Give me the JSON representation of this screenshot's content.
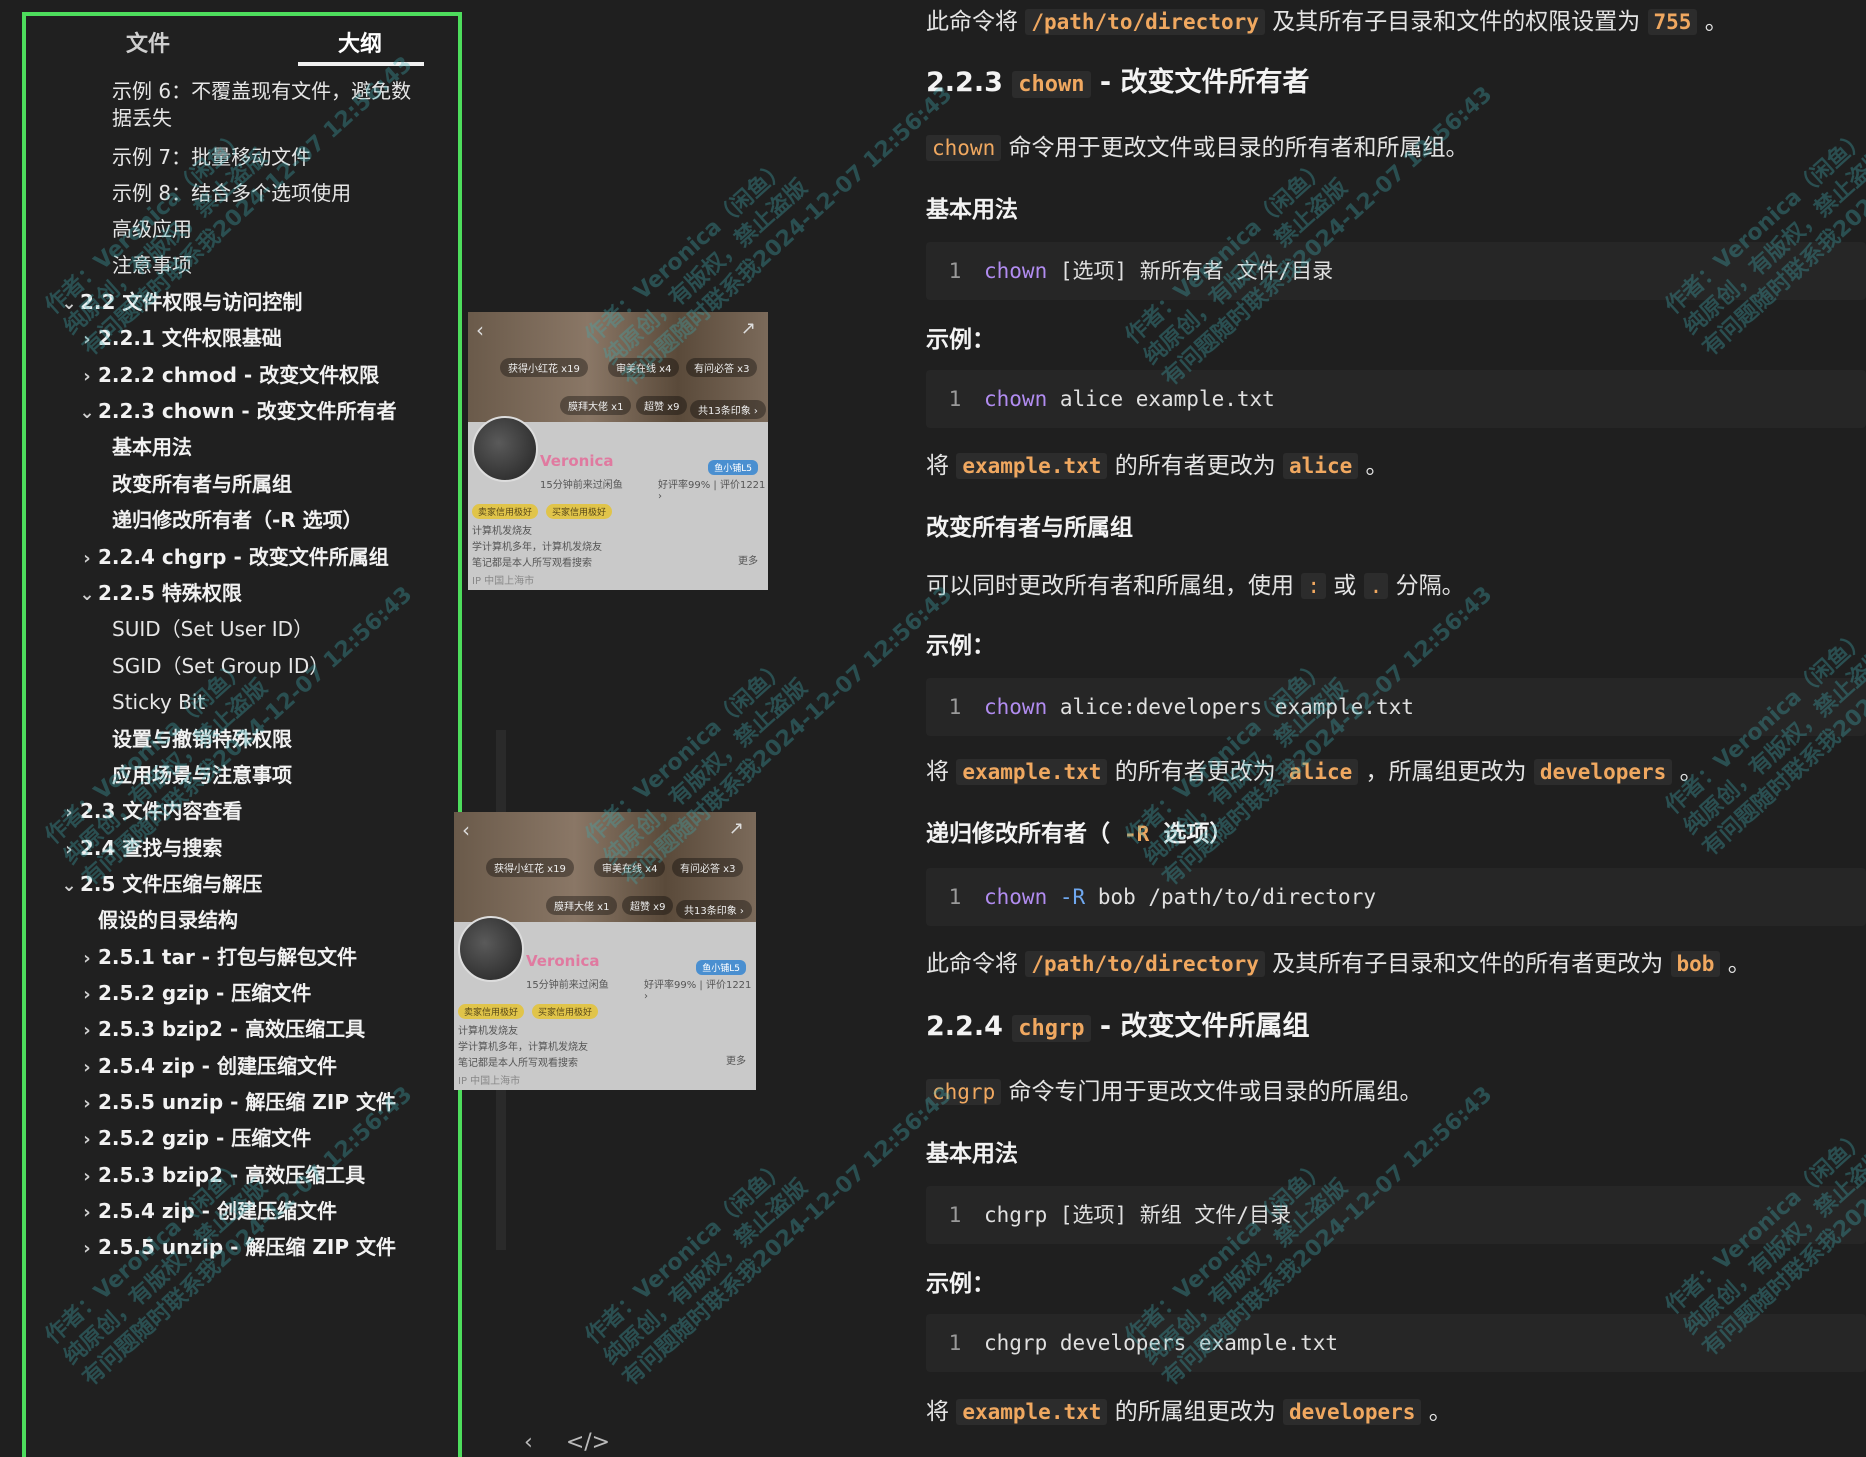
{
  "sidebar": {
    "tabs": [
      {
        "label": "文件",
        "active": false
      },
      {
        "label": "大纲",
        "active": true
      }
    ],
    "items": [
      {
        "text": "示例 6：不覆盖现有文件，避免数据丢失",
        "level": 3,
        "caret": ""
      },
      {
        "text": "示例 7：批量移动文件",
        "level": 3,
        "caret": ""
      },
      {
        "text": "示例 8：结合多个选项使用",
        "level": 3,
        "caret": ""
      },
      {
        "text": "高级应用",
        "level": 3,
        "caret": ""
      },
      {
        "text": "注意事项",
        "level": 3,
        "caret": ""
      },
      {
        "text": "2.2 文件权限与访问控制",
        "level": 1,
        "caret": "⌄"
      },
      {
        "text": "2.2.1 文件权限基础",
        "level": 2,
        "caret": "›"
      },
      {
        "text": "2.2.2 chmod - 改变文件权限",
        "level": 2,
        "caret": "›"
      },
      {
        "text": "2.2.3 chown - 改变文件所有者",
        "level": 2,
        "caret": "⌄"
      },
      {
        "text": "基本用法",
        "level": 3,
        "caret": ""
      },
      {
        "text": "改变所有者与所属组",
        "level": 3,
        "caret": ""
      },
      {
        "text": "递归修改所有者（-R 选项）",
        "level": 3,
        "caret": ""
      },
      {
        "text": "2.2.4 chgrp - 改变文件所属组",
        "level": 2,
        "caret": "›"
      },
      {
        "text": "2.2.5 特殊权限",
        "level": 2,
        "caret": "⌄"
      },
      {
        "text": "SUID（Set User ID）",
        "level": 3,
        "caret": ""
      },
      {
        "text": "SGID（Set Group ID）",
        "level": 3,
        "caret": ""
      },
      {
        "text": "Sticky Bit",
        "level": 3,
        "caret": ""
      },
      {
        "text": "设置与撤销特殊权限",
        "level": 3,
        "caret": ""
      },
      {
        "text": "应用场景与注意事项",
        "level": 3,
        "caret": ""
      },
      {
        "text": "2.3 文件内容查看",
        "level": 1,
        "caret": "›"
      },
      {
        "text": "2.4 查找与搜索",
        "level": 1,
        "caret": "›"
      },
      {
        "text": "2.5 文件压缩与解压",
        "level": 1,
        "caret": "⌄"
      },
      {
        "text": "假设的目录结构",
        "level": 2,
        "caret": ""
      },
      {
        "text": "2.5.1 tar - 打包与解包文件",
        "level": 2,
        "caret": "›"
      },
      {
        "text": "2.5.2 gzip - 压缩文件",
        "level": 2,
        "caret": "›"
      },
      {
        "text": "2.5.3 bzip2 - 高效压缩工具",
        "level": 2,
        "caret": "›"
      },
      {
        "text": "2.5.4 zip - 创建压缩文件",
        "level": 2,
        "caret": "›"
      },
      {
        "text": "2.5.5 unzip - 解压缩 ZIP 文件",
        "level": 2,
        "caret": "›"
      },
      {
        "text": "2.5.2 gzip - 压缩文件",
        "level": 2,
        "caret": "›"
      },
      {
        "text": "2.5.3 bzip2 - 高效压缩工具",
        "level": 2,
        "caret": "›"
      },
      {
        "text": "2.5.4 zip - 创建压缩文件",
        "level": 2,
        "caret": "›"
      },
      {
        "text": "2.5.5 unzip - 解压缩 ZIP 文件",
        "level": 2,
        "caret": "›"
      }
    ]
  },
  "profile_card": {
    "badges": [
      "获得小红花 x19",
      "审美在线 x4",
      "有问必答 x3",
      "膜拜大佬 x1",
      "超赞 x9"
    ],
    "impressions": "共13条印象 ›",
    "name": "Veronica",
    "subtitle": "15分钟前来过闲鱼",
    "level": "鱼小铺L5",
    "rating": "好评率99% | 评价1221 ›",
    "tags": [
      "卖家信用极好",
      "买家信用极好"
    ],
    "line1": "计算机发烧友",
    "line2": "学计算机多年，计算机发烧友",
    "line3": "笔记都是本人所写观看搜索",
    "location": "IP 中国上海市",
    "more": "更多"
  },
  "bottom_icons": {
    "prev": "‹",
    "code": "</>"
  },
  "content": {
    "line1_pre": "此命令将",
    "line1_code1": "/path/to/directory",
    "line1_mid": "及其所有子目录和文件的权限设置为",
    "line1_code2": "755",
    "line1_post": "。",
    "h_chown_num": "2.2.3",
    "h_chown_code": "chown",
    "h_chown_text": "- 改变文件所有者",
    "chown_desc_code": "chown",
    "chown_desc": "命令用于更改文件或目录的所有者和所属组。",
    "basic_usage": "基本用法",
    "code1_ln": "1",
    "code1_cmd": "chown",
    "code1_rest": "[选项] 新所有者 文件/目录",
    "example": "示例：",
    "code2_ln": "1",
    "code2_cmd": "chown",
    "code2_rest": "alice example.txt",
    "p2_pre": "将",
    "p2_code1": "example.txt",
    "p2_mid": "的所有者更改为",
    "p2_code2": "alice",
    "p2_post": "。",
    "h_owner_group": "改变所有者与所属组",
    "p3": "可以同时更改所有者和所属组，使用",
    "p3_code1": ":",
    "p3_or": "或",
    "p3_code2": ".",
    "p3_post": "分隔。",
    "example2": "示例：",
    "code3_ln": "1",
    "code3_cmd": "chown",
    "code3_rest": "alice:developers example.txt",
    "p4_pre": "将",
    "p4_code1": "example.txt",
    "p4_mid": "的所有者更改为",
    "p4_code2": "alice",
    "p4_mid2": "，所属组更改为",
    "p4_code3": "developers",
    "p4_post": "。",
    "h_recursive_pre": "递归修改所有者（",
    "h_recursive_code": "-R",
    "h_recursive_post": "选项）",
    "code4_ln": "1",
    "code4_cmd": "chown",
    "code4_flag": "-R",
    "code4_rest": "bob /path/to/directory",
    "p5_pre": "此命令将",
    "p5_code1": "/path/to/directory",
    "p5_mid": "及其所有子目录和文件的所有者更改为",
    "p5_code2": "bob",
    "p5_post": "。",
    "h_chgrp_num": "2.2.4",
    "h_chgrp_code": "chgrp",
    "h_chgrp_text": "- 改变文件所属组",
    "chgrp_desc_code": "chgrp",
    "chgrp_desc": "命令专门用于更改文件或目录的所属组。",
    "basic_usage2": "基本用法",
    "code5_ln": "1",
    "code5_rest": "chgrp [选项] 新组 文件/目录",
    "example3": "示例：",
    "code6_ln": "1",
    "code6_rest": "chgrp developers example.txt",
    "p6_pre": "将",
    "p6_code1": "example.txt",
    "p6_mid": "的所属组更改为",
    "p6_code2": "developers",
    "p6_post": "。"
  },
  "watermark": {
    "line1": "作者：Veronica（闲鱼）",
    "line2": "纯原创，有版权，禁止盗版",
    "line3": "有问题随时联系我2024-12-07 12:56:43"
  },
  "colors": {
    "accent_border": "#4ddc5c",
    "inline_code": "#f0a860",
    "keyword": "#b18cf0",
    "flag": "#6fa8f0",
    "watermark": "#40a8b0"
  }
}
